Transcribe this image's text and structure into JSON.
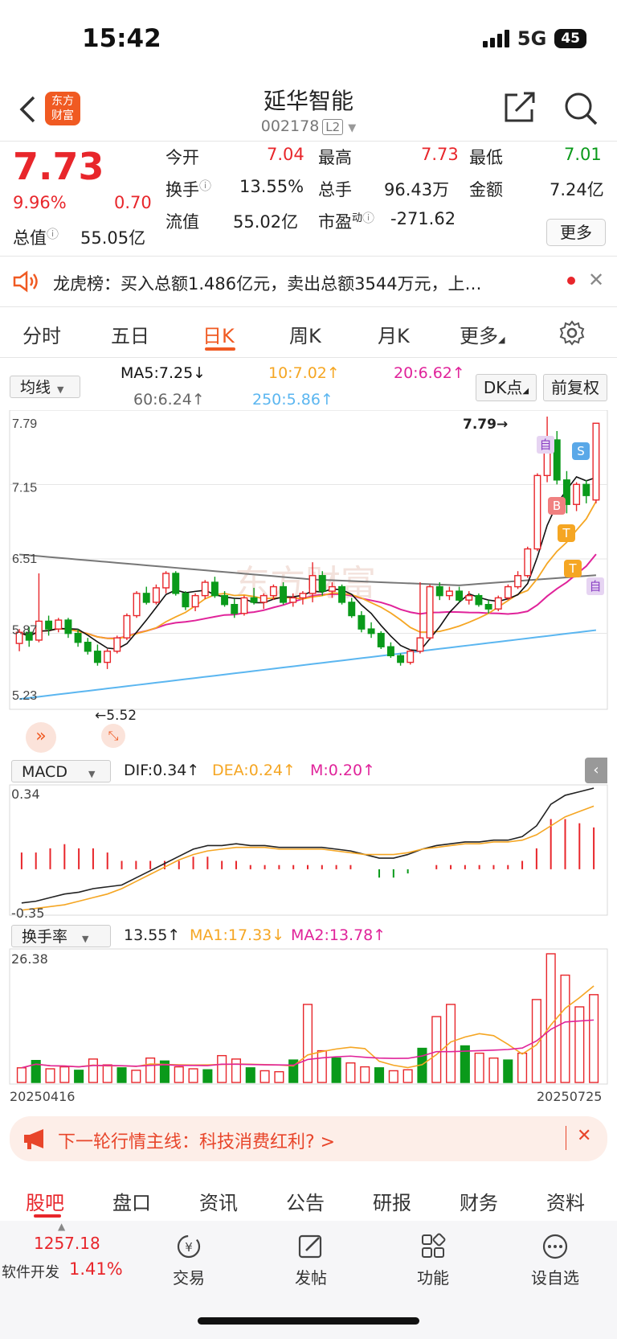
{
  "status": {
    "time": "15:42",
    "network": "5G",
    "battery": "45"
  },
  "nav": {
    "back_icon": "chevron-left-icon",
    "logo_line1": "东方",
    "logo_line2": "财富",
    "title": "延华智能",
    "code": "002178",
    "level": "L2"
  },
  "quote": {
    "price": "7.73",
    "change_pct": "9.96%",
    "change": "0.70",
    "open_label": "今开",
    "open": "7.04",
    "high_label": "最高",
    "high": "7.73",
    "low_label": "最低",
    "low": "7.01",
    "turnover_label": "换手",
    "turnover": "13.55%",
    "volume_label": "总手",
    "volume": "96.43万",
    "amount_label": "金额",
    "amount": "7.24亿",
    "mcap_label": "总值",
    "mcap": "55.05亿",
    "float_label": "流值",
    "float": "55.02亿",
    "pe_label": "市盈",
    "pe_sup": "动",
    "pe": "-271.62",
    "more": "更多"
  },
  "notice": {
    "text": "龙虎榜：买入总额1.486亿元，卖出总额3544万元，上…"
  },
  "tabs": [
    "分时",
    "五日",
    "日K",
    "周K",
    "月K",
    "更多"
  ],
  "active_tab": "日K",
  "kline": {
    "indicator_select": "均线",
    "ma5": "MA5:7.25↓",
    "ma10": "10:7.02↑",
    "ma20": "20:6.62↑",
    "ma60": "60:6.24↑",
    "ma250": "250:5.86↑",
    "dk_button": "DK点",
    "adjust_button": "前复权",
    "y_labels": [
      "7.79",
      "7.15",
      "6.51",
      "5.87",
      "5.23"
    ],
    "high_marker": "7.79→",
    "low_marker": "←5.52",
    "tags": {
      "zi": "自",
      "b": "B",
      "s": "S",
      "t": "T"
    }
  },
  "macd": {
    "select": "MACD",
    "dif": "DIF:0.34↑",
    "dea": "DEA:0.24↑",
    "m": "M:0.20↑",
    "y_top": "0.34",
    "y_bottom": "-0.35"
  },
  "turnover_panel": {
    "select": "换手率",
    "value": "13.55↑",
    "ma1": "MA1:17.33↓",
    "ma2": "MA2:13.78↑",
    "y_top": "26.38",
    "date_start": "20250416",
    "date_end": "20250725"
  },
  "watermark": "东方财富",
  "promo": {
    "text": "下一轮行情主线：科技消费红利? >"
  },
  "bottom_tabs": [
    "股吧",
    "盘口",
    "资讯",
    "公告",
    "研报",
    "财务",
    "资料"
  ],
  "dock": {
    "index_value": "1257.18",
    "index_name": "软件开发",
    "index_pct": "1.41%",
    "trade": "交易",
    "post": "发帖",
    "func": "功能",
    "watch": "设自选"
  },
  "colors": {
    "up": "#e8262b",
    "down": "#0a9a1a",
    "accent": "#f05a22",
    "ma5": "#111111",
    "ma10": "#f5a623",
    "ma20": "#e0239a",
    "ma60": "#777777",
    "ma250": "#5bb6f0"
  },
  "chart_data": {
    "type": "candlestick",
    "ylim": [
      5.23,
      7.79
    ],
    "candles": [
      [
        5.75,
        5.88,
        5.68,
        5.85
      ],
      [
        5.85,
        5.9,
        5.72,
        5.78
      ],
      [
        5.78,
        6.38,
        5.76,
        5.95
      ],
      [
        5.95,
        6.0,
        5.82,
        5.88
      ],
      [
        5.88,
        5.98,
        5.85,
        5.96
      ],
      [
        5.96,
        5.98,
        5.8,
        5.84
      ],
      [
        5.84,
        5.88,
        5.72,
        5.76
      ],
      [
        5.76,
        5.8,
        5.65,
        5.68
      ],
      [
        5.68,
        5.74,
        5.55,
        5.58
      ],
      [
        5.58,
        5.7,
        5.52,
        5.68
      ],
      [
        5.68,
        5.82,
        5.66,
        5.8
      ],
      [
        5.8,
        6.02,
        5.78,
        6.0
      ],
      [
        6.0,
        6.22,
        5.98,
        6.2
      ],
      [
        6.2,
        6.26,
        6.1,
        6.12
      ],
      [
        6.12,
        6.28,
        6.1,
        6.25
      ],
      [
        6.25,
        6.4,
        6.2,
        6.38
      ],
      [
        6.38,
        6.4,
        6.18,
        6.2
      ],
      [
        6.2,
        6.22,
        6.05,
        6.08
      ],
      [
        6.08,
        6.2,
        6.04,
        6.18
      ],
      [
        6.18,
        6.32,
        6.15,
        6.3
      ],
      [
        6.3,
        6.35,
        6.16,
        6.18
      ],
      [
        6.18,
        6.22,
        6.08,
        6.1
      ],
      [
        6.1,
        6.15,
        5.98,
        6.02
      ],
      [
        6.02,
        6.18,
        6.0,
        6.16
      ],
      [
        6.16,
        6.25,
        6.1,
        6.12
      ],
      [
        6.12,
        6.2,
        6.06,
        6.18
      ],
      [
        6.18,
        6.28,
        6.14,
        6.26
      ],
      [
        6.26,
        6.3,
        6.1,
        6.12
      ],
      [
        6.12,
        6.2,
        6.08,
        6.16
      ],
      [
        6.16,
        6.22,
        6.1,
        6.2
      ],
      [
        6.2,
        6.48,
        6.12,
        6.36
      ],
      [
        6.36,
        6.4,
        6.18,
        6.22
      ],
      [
        6.22,
        6.3,
        6.16,
        6.26
      ],
      [
        6.26,
        6.28,
        6.1,
        6.12
      ],
      [
        6.12,
        6.16,
        5.98,
        6.0
      ],
      [
        6.0,
        6.04,
        5.85,
        5.88
      ],
      [
        5.88,
        5.94,
        5.8,
        5.84
      ],
      [
        5.84,
        5.86,
        5.7,
        5.72
      ],
      [
        5.72,
        5.76,
        5.62,
        5.64
      ],
      [
        5.64,
        5.66,
        5.55,
        5.58
      ],
      [
        5.58,
        5.7,
        5.56,
        5.68
      ],
      [
        5.68,
        6.3,
        5.66,
        5.8
      ],
      [
        5.8,
        6.28,
        5.78,
        6.26
      ],
      [
        6.26,
        6.3,
        6.14,
        6.18
      ],
      [
        6.18,
        6.26,
        6.14,
        6.22
      ],
      [
        6.22,
        6.26,
        6.12,
        6.14
      ],
      [
        6.14,
        6.22,
        6.1,
        6.18
      ],
      [
        6.18,
        6.2,
        6.08,
        6.1
      ],
      [
        6.1,
        6.14,
        6.02,
        6.06
      ],
      [
        6.06,
        6.18,
        6.04,
        6.16
      ],
      [
        6.16,
        6.28,
        6.14,
        6.26
      ],
      [
        6.26,
        6.4,
        6.24,
        6.36
      ],
      [
        6.36,
        6.62,
        6.34,
        6.6
      ],
      [
        6.6,
        7.28,
        6.58,
        7.26
      ],
      [
        7.26,
        7.79,
        7.2,
        7.58
      ],
      [
        7.58,
        7.66,
        7.18,
        7.22
      ],
      [
        7.22,
        7.3,
        6.92,
        7.0
      ],
      [
        7.0,
        7.2,
        6.94,
        7.18
      ],
      [
        7.18,
        7.22,
        7.01,
        7.08
      ],
      [
        7.04,
        7.73,
        7.01,
        7.73
      ]
    ],
    "macd_dif": [
      -0.3,
      -0.29,
      -0.27,
      -0.25,
      -0.24,
      -0.22,
      -0.21,
      -0.2,
      -0.16,
      -0.12,
      -0.08,
      -0.04,
      0.0,
      0.02,
      0.02,
      0.03,
      0.02,
      0.02,
      0.01,
      0.01,
      0.01,
      0.01,
      0.0,
      -0.01,
      -0.03,
      -0.05,
      -0.05,
      -0.03,
      0.0,
      0.02,
      0.03,
      0.04,
      0.04,
      0.05,
      0.05,
      0.07,
      0.13,
      0.25,
      0.3,
      0.32,
      0.34
    ],
    "macd_dea": [
      -0.34,
      -0.33,
      -0.32,
      -0.31,
      -0.29,
      -0.27,
      -0.25,
      -0.22,
      -0.18,
      -0.14,
      -0.1,
      -0.06,
      -0.03,
      -0.01,
      0.0,
      0.01,
      0.01,
      0.01,
      0.0,
      0.0,
      0.0,
      0.0,
      -0.01,
      -0.02,
      -0.03,
      -0.03,
      -0.03,
      -0.02,
      0.0,
      0.01,
      0.02,
      0.03,
      0.03,
      0.04,
      0.04,
      0.05,
      0.08,
      0.13,
      0.18,
      0.21,
      0.24
    ],
    "turnover": [
      3.0,
      4.5,
      2.8,
      3.2,
      2.5,
      4.8,
      3.6,
      3.0,
      2.5,
      5.0,
      4.4,
      3.2,
      2.8,
      2.6,
      5.5,
      4.8,
      3.0,
      2.4,
      2.2,
      4.6,
      16.0,
      6.5,
      5.0,
      4.0,
      3.2,
      3.0,
      2.4,
      2.6,
      7.0,
      13.5,
      16.0,
      7.5,
      6.0,
      5.0,
      4.6,
      6.0,
      17.0,
      26.38,
      22.0,
      15.5,
      18.0
    ]
  }
}
